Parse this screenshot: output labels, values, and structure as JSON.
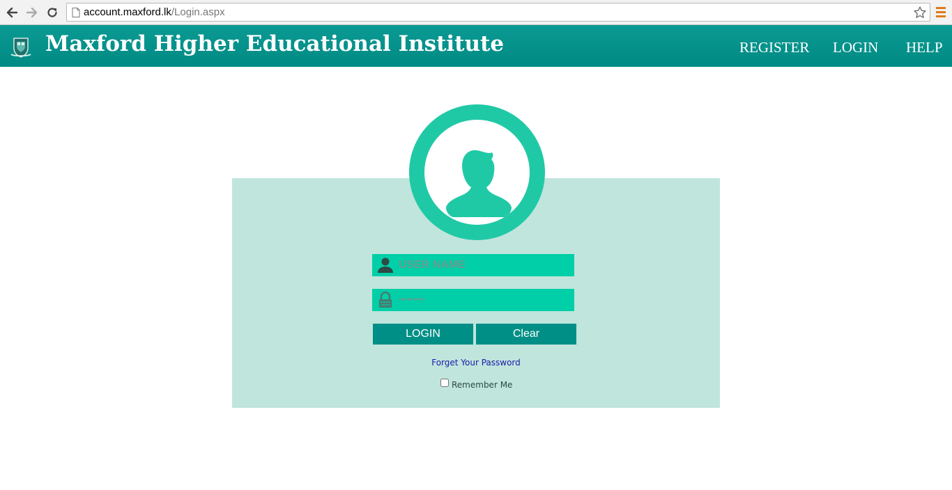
{
  "browser": {
    "url_host": "account.maxford.lk",
    "url_path": "/Login.aspx",
    "icons": [
      "back-icon",
      "forward-icon",
      "reload-icon",
      "page-icon",
      "bookmark-star-icon",
      "menu-icon"
    ]
  },
  "header": {
    "title": "Maxford Higher Educational Institute",
    "nav": [
      "REGISTER",
      "LOGIN",
      "HELP"
    ],
    "colors": {
      "header_bg": "#009590",
      "text": "#ffffff"
    }
  },
  "login": {
    "username_placeholder": "USER NAME",
    "password_masked": "•••••••••",
    "login_label": "LOGIN",
    "clear_label": "Clear",
    "forgot_label": "Forget Your Password",
    "remember_label": "Remember Me",
    "colors": {
      "panel_bg": "#c0e5dd",
      "field_bg": "#00cfa7",
      "button_bg": "#008f86",
      "avatar": "#20c9a6"
    }
  }
}
